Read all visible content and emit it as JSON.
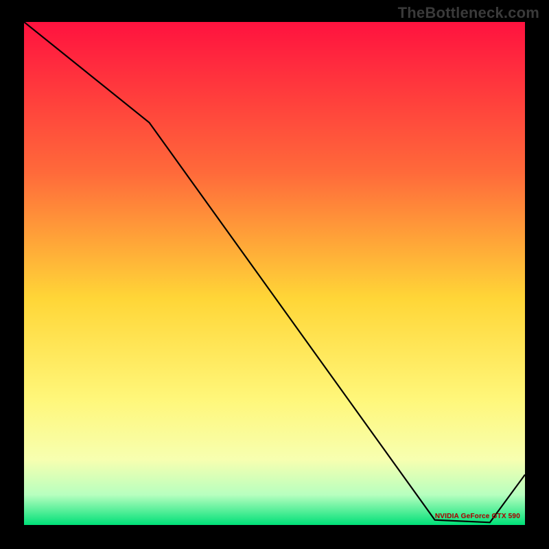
{
  "watermark": "TheBottleneck.com",
  "chart_data": {
    "type": "line",
    "title": "",
    "xlabel": "",
    "ylabel": "",
    "xlim": [
      0,
      100
    ],
    "ylim": [
      0,
      100
    ],
    "series": [
      {
        "name": "NVIDIA GeForce GTX 590",
        "x": [
          0,
          25,
          82,
          93,
          100
        ],
        "values": [
          100,
          80,
          1,
          0.5,
          10
        ]
      }
    ],
    "background_gradient": {
      "stops": [
        {
          "pos": 0.0,
          "color": "#ff123f"
        },
        {
          "pos": 0.3,
          "color": "#ff6a3a"
        },
        {
          "pos": 0.55,
          "color": "#ffd637"
        },
        {
          "pos": 0.75,
          "color": "#fff77a"
        },
        {
          "pos": 0.87,
          "color": "#f7ffb0"
        },
        {
          "pos": 0.94,
          "color": "#b7ffbf"
        },
        {
          "pos": 1.0,
          "color": "#00e078"
        }
      ]
    },
    "colors": {
      "line": "#000000",
      "series_label": "#b00000"
    }
  }
}
